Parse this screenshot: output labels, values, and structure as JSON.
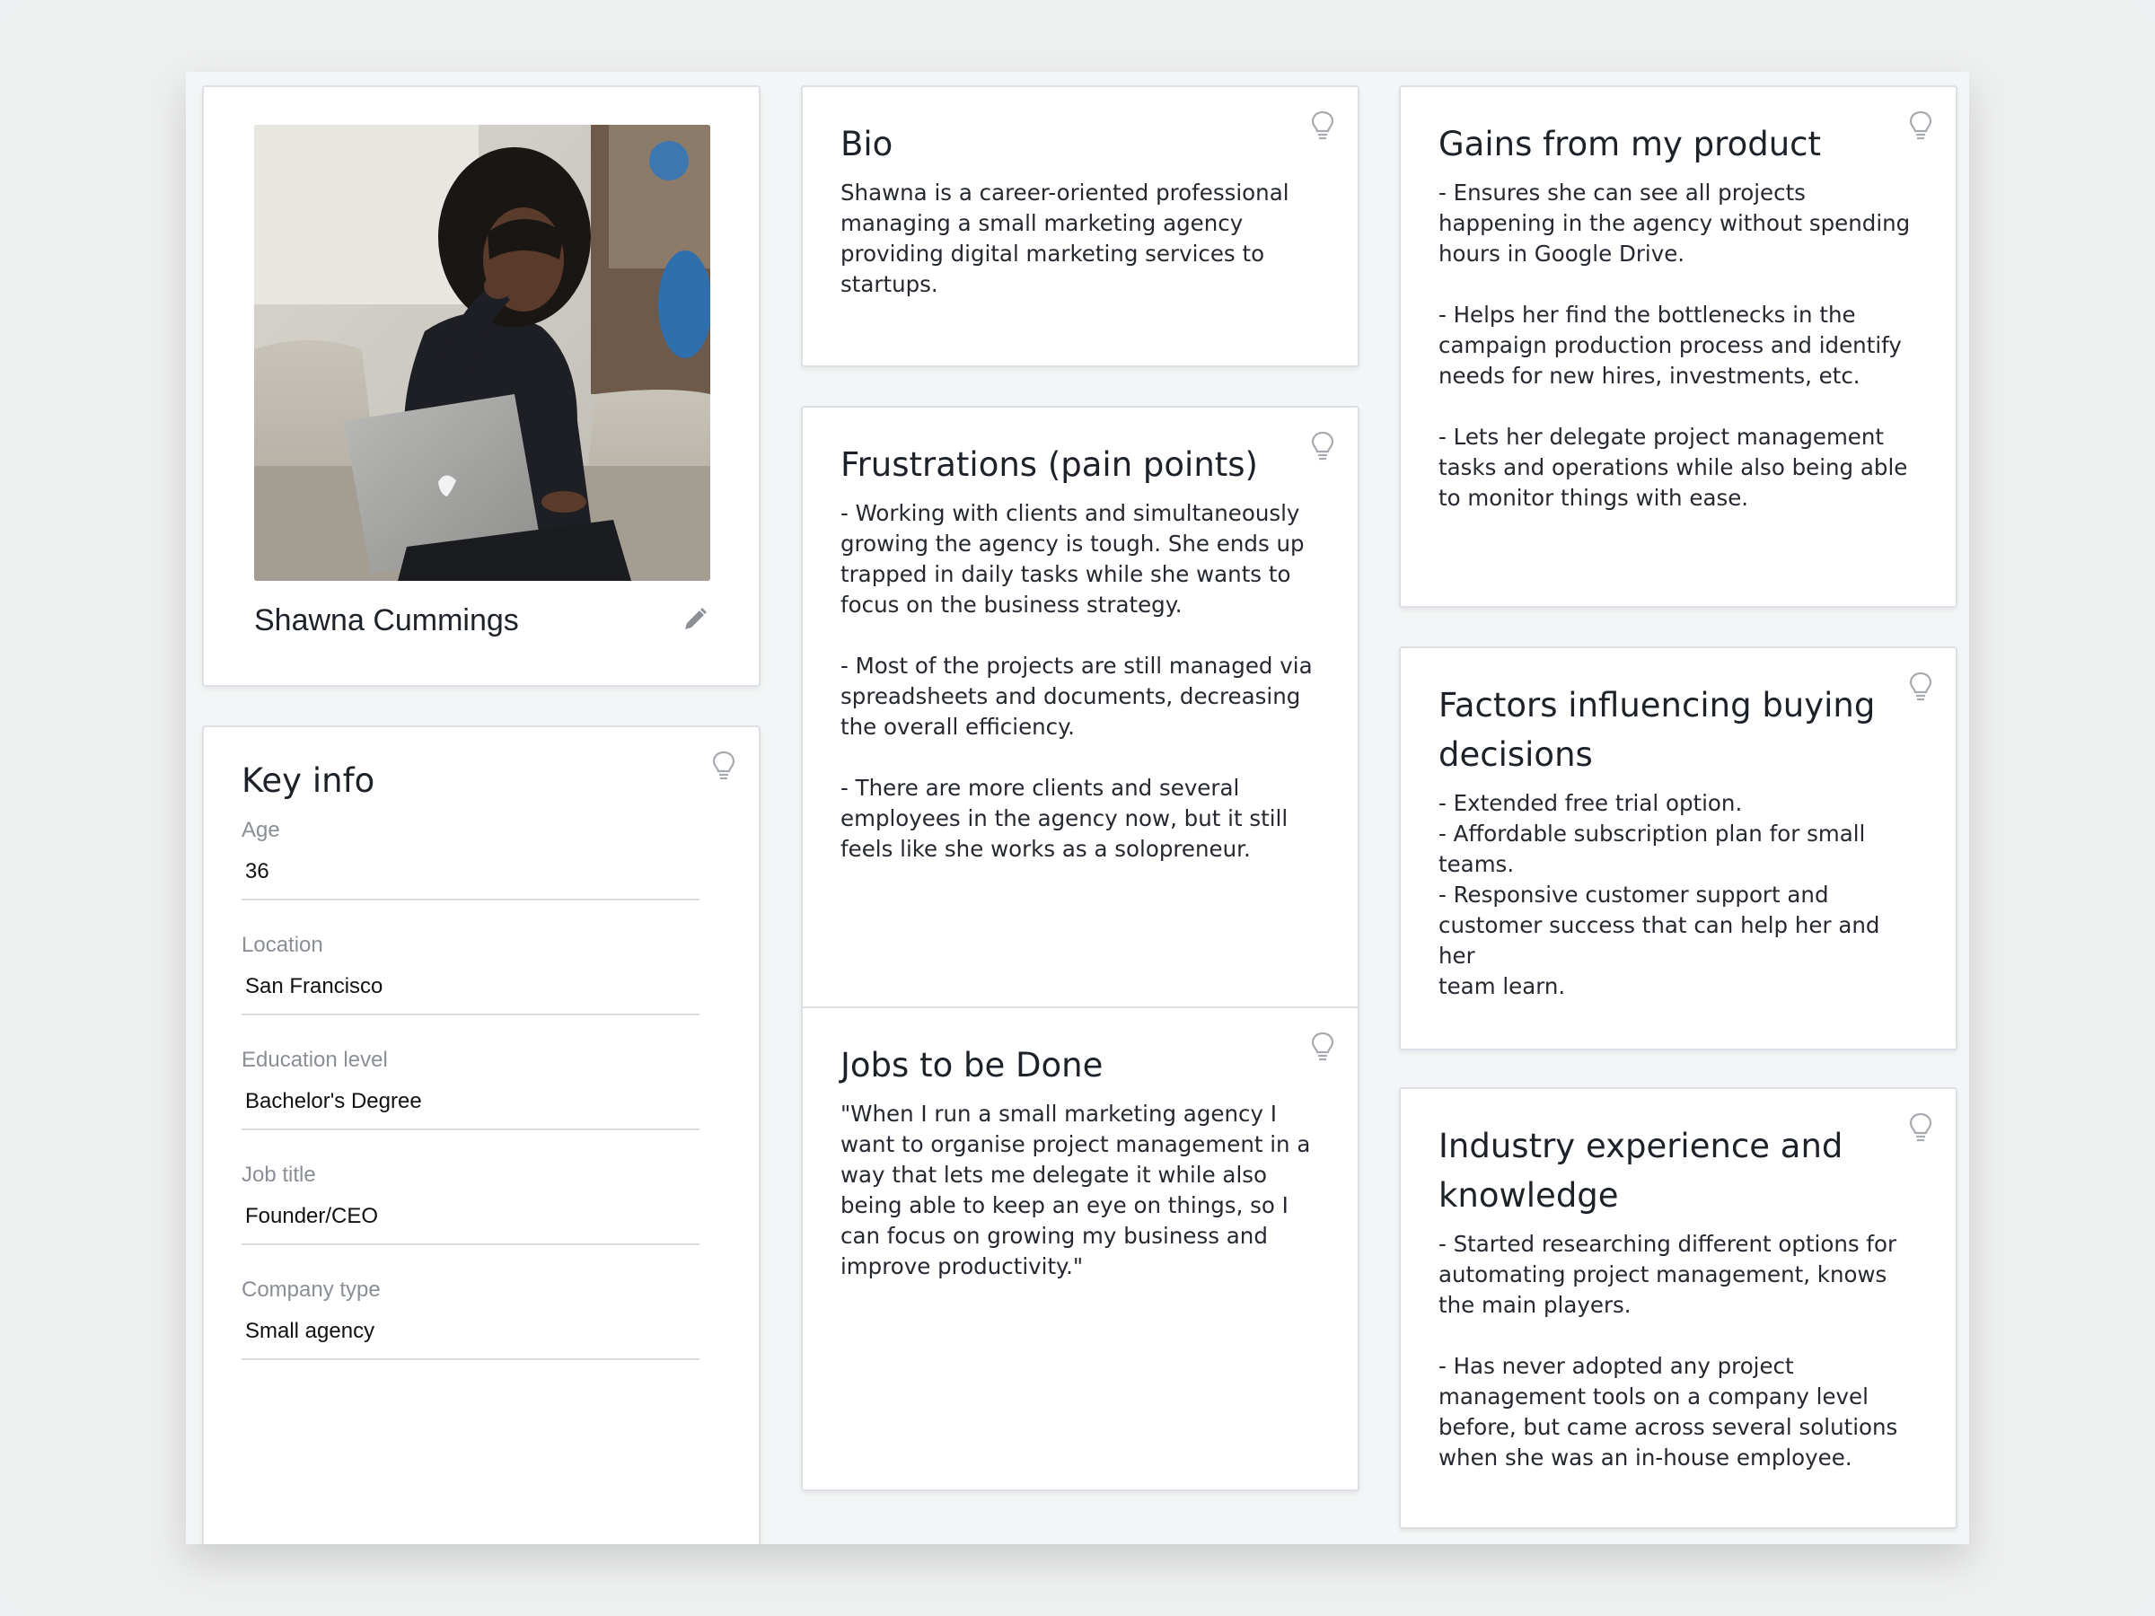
{
  "persona": {
    "name": "Shawna Cummings",
    "photo_alt": "Shawna Cummings"
  },
  "key_info": {
    "title": "Key info",
    "fields": [
      {
        "label": "Age",
        "value": "36"
      },
      {
        "label": "Location",
        "value": "San Francisco"
      },
      {
        "label": "Education level",
        "value": "Bachelor's Degree"
      },
      {
        "label": "Job title",
        "value": "Founder/CEO"
      },
      {
        "label": "Company type",
        "value": "Small agency"
      }
    ]
  },
  "bio": {
    "title": "Bio",
    "text": "Shawna is a career-oriented professional\nmanaging a small marketing agency\nproviding digital marketing services to\nstartups."
  },
  "frustrations": {
    "title": "Frustrations (pain points)",
    "text": "- Working with clients and simultaneously\ngrowing the agency is tough. She ends up\ntrapped in daily tasks while she wants to\nfocus on the business strategy.\n\n- Most of the projects are still managed via\nspreadsheets and documents, decreasing\nthe overall efficiency.\n\n- There are more clients and several\nemployees in the agency now, but it still\nfeels like she works as a solopreneur."
  },
  "jobs": {
    "title": "Jobs to be Done",
    "text": "\"When I run a small marketing agency I\nwant to organise project management in a\nway that lets me delegate it while also\nbeing able to keep an eye on things, so I\ncan focus on growing my business and\nimprove productivity.\""
  },
  "gains": {
    "title": "Gains from my product",
    "text": "- Ensures she can see all projects\nhappening in the agency without spending\nhours in Google Drive.\n\n- Helps her find the bottlenecks in the\ncampaign production process and identify\nneeds for new hires, investments, etc.\n\n- Lets her delegate project management\ntasks and operations while also being able\nto monitor things with ease."
  },
  "factors": {
    "title": "Factors influencing buying decisions",
    "text": "- Extended free trial option.\n- Affordable subscription plan for small\nteams.\n- Responsive customer support and\ncustomer success that can help her and her\nteam learn."
  },
  "industry": {
    "title": "Industry experience and knowledge",
    "text": "- Started researching different options for\nautomating project management, knows\nthe main players.\n\n- Has never adopted any project\nmanagement tools on a company level\nbefore, but came across several solutions\nwhen she was an in-house employee."
  },
  "icons": {
    "bulb": "lightbulb-icon",
    "edit": "pencil-icon"
  }
}
